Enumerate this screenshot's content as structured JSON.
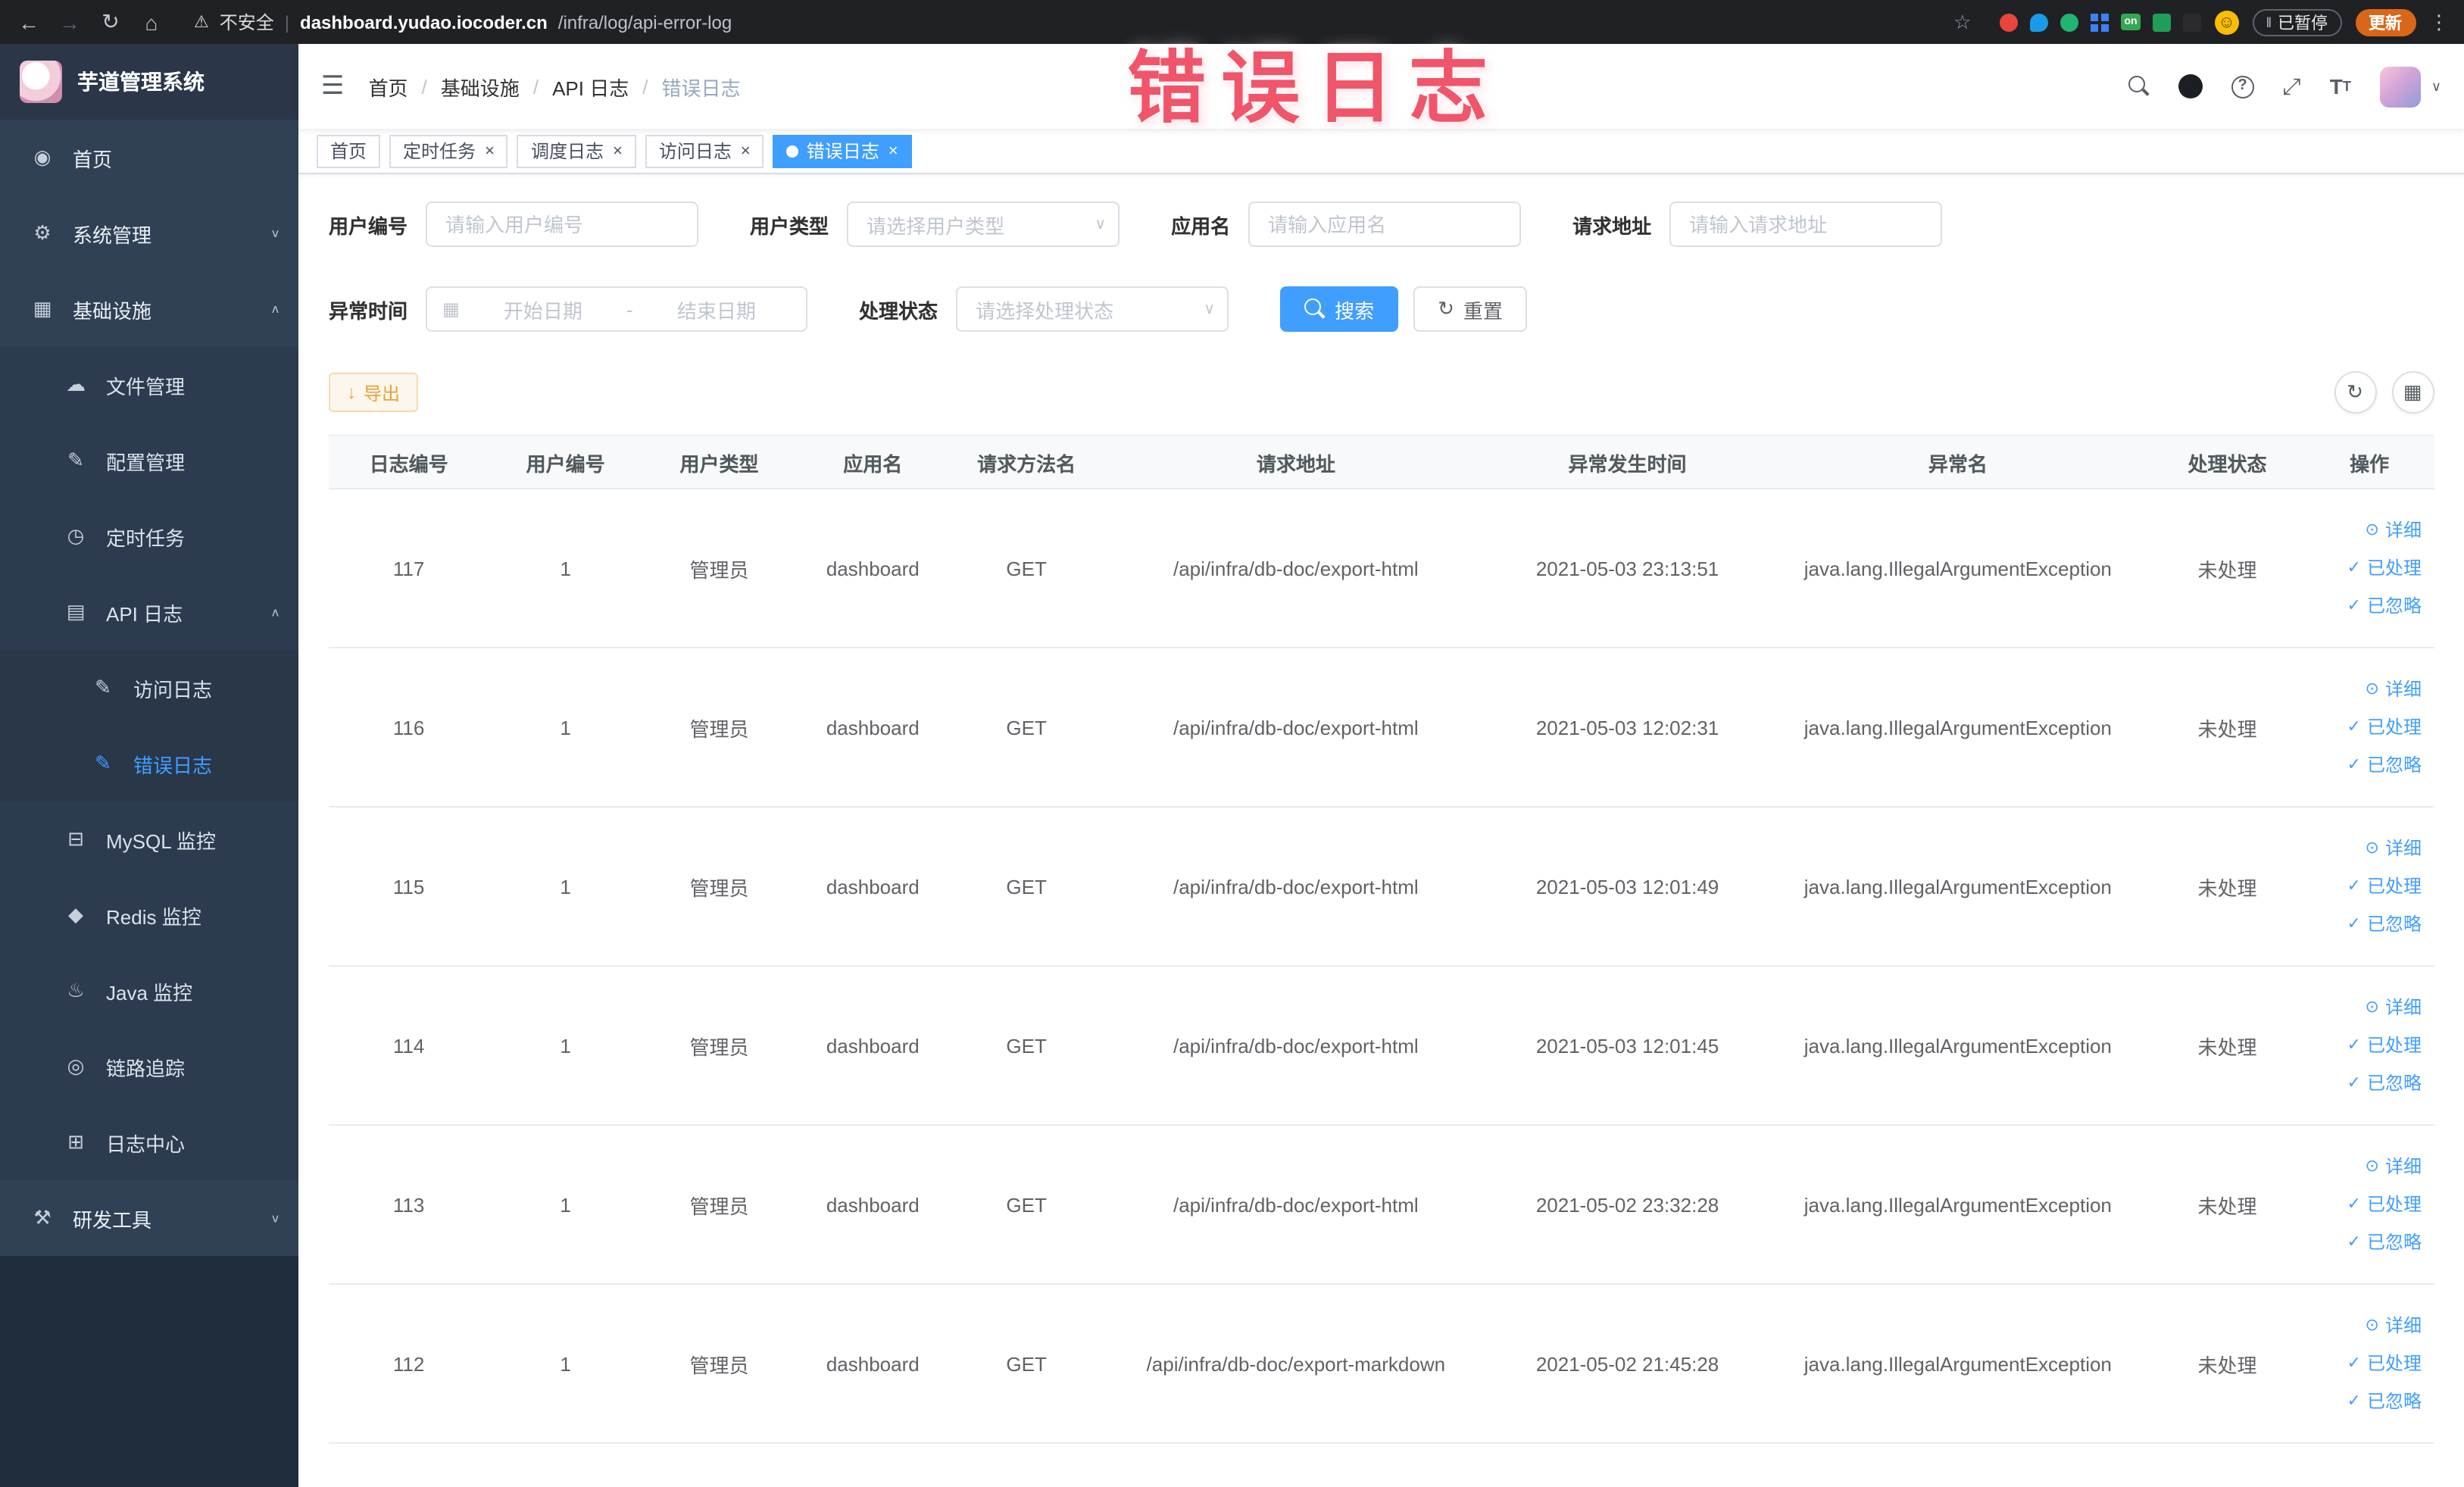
{
  "colors": {
    "accent": "#409EFF",
    "sidebar_bg": "#304156",
    "annotation_red": "#F0556A",
    "warning": "#E6A23C"
  },
  "annotation": {
    "text": "错误日志"
  },
  "browser": {
    "security_label": "不安全",
    "url_host": "dashboard.yudao.iocoder.cn",
    "url_path": "/infra/log/api-error-log",
    "ext_on_label": "on",
    "paused_label": "已暂停",
    "update_label": "更新"
  },
  "sidebar": {
    "logo_title": "芋道管理系统",
    "items": [
      {
        "name": "home",
        "label": "首页",
        "icon": "dashboard",
        "level": 0
      },
      {
        "name": "system",
        "label": "系统管理",
        "icon": "gear",
        "level": 0,
        "chevron": "down"
      },
      {
        "name": "infra",
        "label": "基础设施",
        "icon": "infra",
        "level": 0,
        "chevron": "up"
      },
      {
        "name": "file",
        "label": "文件管理",
        "icon": "cloud",
        "level": 1
      },
      {
        "name": "config",
        "label": "配置管理",
        "icon": "edit",
        "level": 1
      },
      {
        "name": "job",
        "label": "定时任务",
        "icon": "clock",
        "level": 1
      },
      {
        "name": "api-log",
        "label": "API 日志",
        "icon": "log",
        "level": 1,
        "chevron": "up"
      },
      {
        "name": "access-log",
        "label": "访问日志",
        "icon": "edit",
        "level": 2
      },
      {
        "name": "error-log",
        "label": "错误日志",
        "icon": "edit",
        "level": 2,
        "active": true
      },
      {
        "name": "mysql",
        "label": "MySQL 监控",
        "icon": "db",
        "level": 1
      },
      {
        "name": "redis",
        "label": "Redis 监控",
        "icon": "redis",
        "level": 1
      },
      {
        "name": "java",
        "label": "Java 监控",
        "icon": "java",
        "level": 1
      },
      {
        "name": "trace",
        "label": "链路追踪",
        "icon": "trace",
        "level": 1
      },
      {
        "name": "log-center",
        "label": "日志中心",
        "icon": "center",
        "level": 1
      },
      {
        "name": "devtools",
        "label": "研发工具",
        "icon": "tools",
        "level": 0,
        "chevron": "down"
      }
    ]
  },
  "header": {
    "breadcrumb": [
      "首页",
      "基础设施",
      "API 日志",
      "错误日志"
    ]
  },
  "tabs": [
    {
      "name": "home",
      "label": "首页",
      "closable": false,
      "active": false
    },
    {
      "name": "job",
      "label": "定时任务",
      "closable": true,
      "active": false
    },
    {
      "name": "job-log",
      "label": "调度日志",
      "closable": true,
      "active": false
    },
    {
      "name": "access-log",
      "label": "访问日志",
      "closable": true,
      "active": false
    },
    {
      "name": "error-log",
      "label": "错误日志",
      "closable": true,
      "active": true
    }
  ],
  "filters": {
    "user_id_label": "用户编号",
    "user_id_placeholder": "请输入用户编号",
    "user_type_label": "用户类型",
    "user_type_placeholder": "请选择用户类型",
    "app_name_label": "应用名",
    "app_name_placeholder": "请输入应用名",
    "request_url_label": "请求地址",
    "request_url_placeholder": "请输入请求地址",
    "exception_time_label": "异常时间",
    "start_placeholder": "开始日期",
    "range_separator": "-",
    "end_placeholder": "结束日期",
    "status_label": "处理状态",
    "status_placeholder": "请选择处理状态",
    "search_label": "搜索",
    "reset_label": "重置"
  },
  "toolbar": {
    "export_label": "导出"
  },
  "table": {
    "headers": [
      "日志编号",
      "用户编号",
      "用户类型",
      "应用名",
      "请求方法名",
      "请求地址",
      "异常发生时间",
      "异常名",
      "处理状态",
      "操作"
    ],
    "actions": [
      {
        "name": "detail",
        "label": "详细",
        "icon": "eye"
      },
      {
        "name": "processed",
        "label": "已处理",
        "icon": "check"
      },
      {
        "name": "ignored",
        "label": "已忽略",
        "icon": "check"
      }
    ],
    "rows": [
      {
        "log_id": "117",
        "user_id": "1",
        "user_type": "管理员",
        "app_name": "dashboard",
        "method": "GET",
        "url": "/api/infra/db-doc/export-html",
        "time": "2021-05-03 23:13:51",
        "exception": "java.lang.IllegalArgumentException",
        "status": "未处理"
      },
      {
        "log_id": "116",
        "user_id": "1",
        "user_type": "管理员",
        "app_name": "dashboard",
        "method": "GET",
        "url": "/api/infra/db-doc/export-html",
        "time": "2021-05-03 12:02:31",
        "exception": "java.lang.IllegalArgumentException",
        "status": "未处理"
      },
      {
        "log_id": "115",
        "user_id": "1",
        "user_type": "管理员",
        "app_name": "dashboard",
        "method": "GET",
        "url": "/api/infra/db-doc/export-html",
        "time": "2021-05-03 12:01:49",
        "exception": "java.lang.IllegalArgumentException",
        "status": "未处理"
      },
      {
        "log_id": "114",
        "user_id": "1",
        "user_type": "管理员",
        "app_name": "dashboard",
        "method": "GET",
        "url": "/api/infra/db-doc/export-html",
        "time": "2021-05-03 12:01:45",
        "exception": "java.lang.IllegalArgumentException",
        "status": "未处理"
      },
      {
        "log_id": "113",
        "user_id": "1",
        "user_type": "管理员",
        "app_name": "dashboard",
        "method": "GET",
        "url": "/api/infra/db-doc/export-html",
        "time": "2021-05-02 23:32:28",
        "exception": "java.lang.IllegalArgumentException",
        "status": "未处理"
      },
      {
        "log_id": "112",
        "user_id": "1",
        "user_type": "管理员",
        "app_name": "dashboard",
        "method": "GET",
        "url": "/api/infra/db-doc/export-markdown",
        "time": "2021-05-02 21:45:28",
        "exception": "java.lang.IllegalArgumentException",
        "status": "未处理"
      }
    ]
  }
}
